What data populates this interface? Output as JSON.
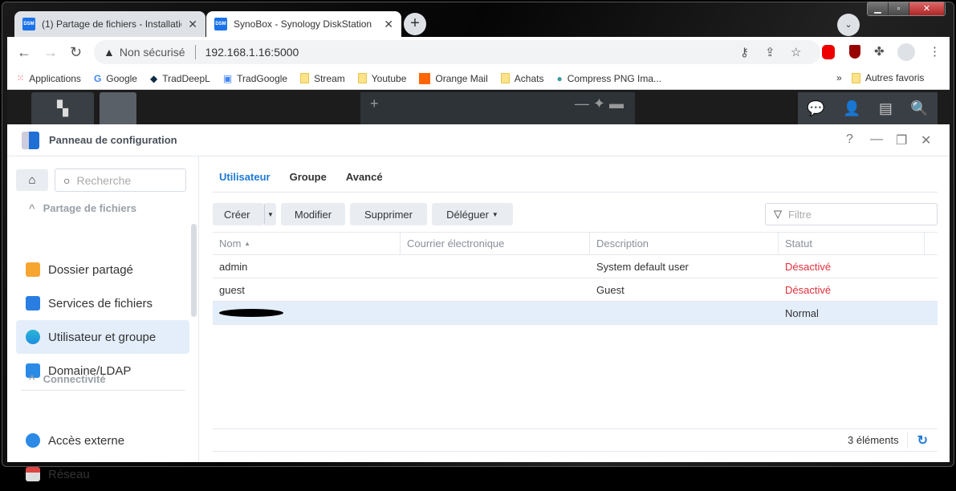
{
  "browser": {
    "tabs": [
      {
        "favicon": "DSM",
        "title": "(1) Partage de fichiers - Installatio"
      },
      {
        "favicon": "DSM",
        "title": "SynoBox - Synology DiskStation"
      }
    ],
    "security": "Non sécurisé",
    "url": "192.168.1.16:5000",
    "bookmarks": [
      "Applications",
      "Google",
      "TradDeepL",
      "TradGoogle",
      "Stream",
      "Youtube",
      "Orange Mail",
      "Achats",
      "Compress PNG Ima..."
    ],
    "other_bookmarks": "Autres favoris"
  },
  "window": {
    "title": "Panneau de configuration"
  },
  "sidebar": {
    "search_placeholder": "Recherche",
    "groups": [
      {
        "label": "Partage de fichiers",
        "items": [
          "Dossier partagé",
          "Services de fichiers",
          "Utilisateur et groupe",
          "Domaine/LDAP"
        ]
      },
      {
        "label": "Connectivité",
        "items": [
          "Accès externe",
          "Réseau"
        ]
      }
    ],
    "selected": "Utilisateur et groupe"
  },
  "main": {
    "tabs": [
      "Utilisateur",
      "Groupe",
      "Avancé"
    ],
    "active_tab": "Utilisateur",
    "buttons": {
      "create": "Créer",
      "modify": "Modifier",
      "delete": "Supprimer",
      "delegate": "Déléguer"
    },
    "filter_placeholder": "Filtre",
    "columns": [
      "Nom",
      "Courrier électronique",
      "Description",
      "Statut"
    ],
    "rows": [
      {
        "name": "admin",
        "email": "",
        "description": "System default user",
        "status": "Désactivé"
      },
      {
        "name": "guest",
        "email": "",
        "description": "Guest",
        "status": "Désactivé"
      },
      {
        "name": "",
        "email": "",
        "description": "",
        "status": "Normal"
      }
    ],
    "count": "3 éléments"
  },
  "colors": {
    "accent": "#1e7ad6",
    "disabled": "#e0303a",
    "selected_row": "#e4eefa"
  }
}
